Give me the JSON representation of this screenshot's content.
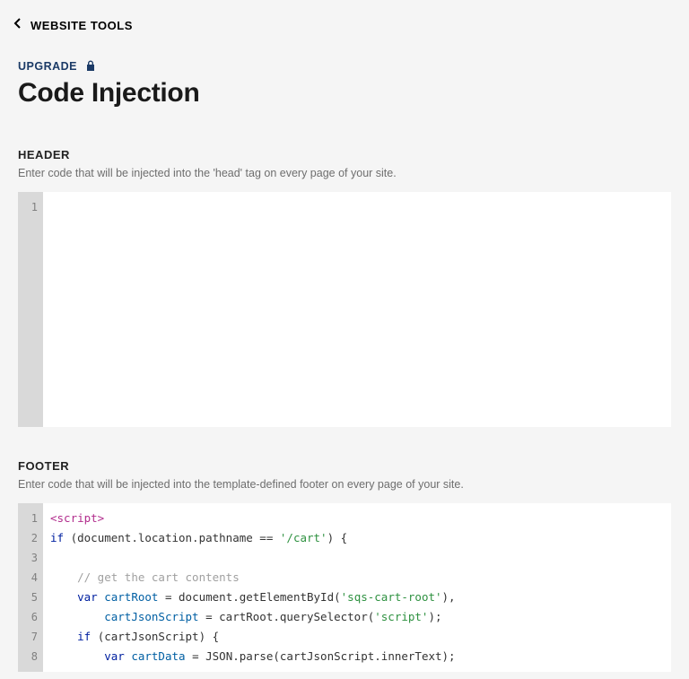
{
  "topbar": {
    "title": "WEBSITE TOOLS"
  },
  "upgrade": {
    "label": "UPGRADE"
  },
  "page": {
    "title": "Code Injection"
  },
  "header_section": {
    "label": "HEADER",
    "help": "Enter code that will be injected into the 'head' tag on every page of your site.",
    "line_numbers": [
      "1"
    ],
    "code": ""
  },
  "footer_section": {
    "label": "FOOTER",
    "help": "Enter code that will be injected into the template-defined footer on every page of your site.",
    "line_numbers": [
      "1",
      "2",
      "3",
      "4",
      "5",
      "6",
      "7",
      "8"
    ],
    "code_tokens": [
      [
        {
          "t": "tag",
          "v": "<script>"
        }
      ],
      [
        {
          "t": "key",
          "v": "if"
        },
        {
          "t": "txt",
          "v": " (document.location.pathname == "
        },
        {
          "t": "str",
          "v": "'/cart'"
        },
        {
          "t": "txt",
          "v": ") {"
        }
      ],
      [],
      [
        {
          "t": "txt",
          "v": "    "
        },
        {
          "t": "cmt",
          "v": "// get the cart contents"
        }
      ],
      [
        {
          "t": "txt",
          "v": "    "
        },
        {
          "t": "key",
          "v": "var"
        },
        {
          "t": "txt",
          "v": " "
        },
        {
          "t": "var",
          "v": "cartRoot"
        },
        {
          "t": "txt",
          "v": " = document.getElementById("
        },
        {
          "t": "str",
          "v": "'sqs-cart-root'"
        },
        {
          "t": "txt",
          "v": "),"
        }
      ],
      [
        {
          "t": "txt",
          "v": "        "
        },
        {
          "t": "var",
          "v": "cartJsonScript"
        },
        {
          "t": "txt",
          "v": " = cartRoot.querySelector("
        },
        {
          "t": "str",
          "v": "'script'"
        },
        {
          "t": "txt",
          "v": ");"
        }
      ],
      [
        {
          "t": "txt",
          "v": "    "
        },
        {
          "t": "key",
          "v": "if"
        },
        {
          "t": "txt",
          "v": " (cartJsonScript) {"
        }
      ],
      [
        {
          "t": "txt",
          "v": "        "
        },
        {
          "t": "key",
          "v": "var"
        },
        {
          "t": "txt",
          "v": " "
        },
        {
          "t": "var",
          "v": "cartData"
        },
        {
          "t": "txt",
          "v": " = JSON.parse(cartJsonScript.innerText);"
        }
      ]
    ]
  }
}
